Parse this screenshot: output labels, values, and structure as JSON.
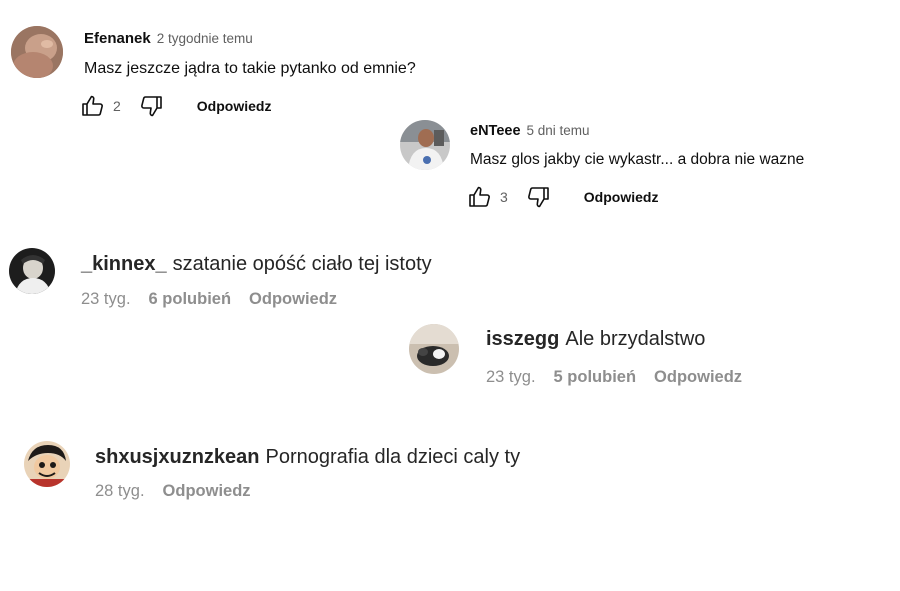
{
  "comments": [
    {
      "author": "Efenanek",
      "time": "2 tygodnie temu",
      "text": "Masz jeszcze jądra to takie pytanko od emnie?",
      "likes": "2",
      "reply": "Odpowiedz"
    },
    {
      "author": "eNTeee",
      "time": "5 dni temu",
      "text": "Masz glos jakby cie wykastr... a dobra nie wazne",
      "likes": "3",
      "reply": "Odpowiedz"
    }
  ],
  "ig_comments": [
    {
      "user": "_kinnex_",
      "text": "szatanie opóść ciało tej istoty",
      "age": "23 tyg.",
      "likes": "6 polubień",
      "reply": "Odpowiedz"
    },
    {
      "user": "isszegg",
      "text": "Ale brzydalstwo",
      "age": "23 tyg.",
      "likes": "5 polubień",
      "reply": "Odpowiedz"
    },
    {
      "user": "shxusjxuznzkean",
      "text": "Pornografia dla dzieci caly ty",
      "age": "28 tyg.",
      "reply": "Odpowiedz"
    }
  ],
  "icons": {
    "like": "thumb-up-outline",
    "dislike": "thumb-down-outline"
  }
}
